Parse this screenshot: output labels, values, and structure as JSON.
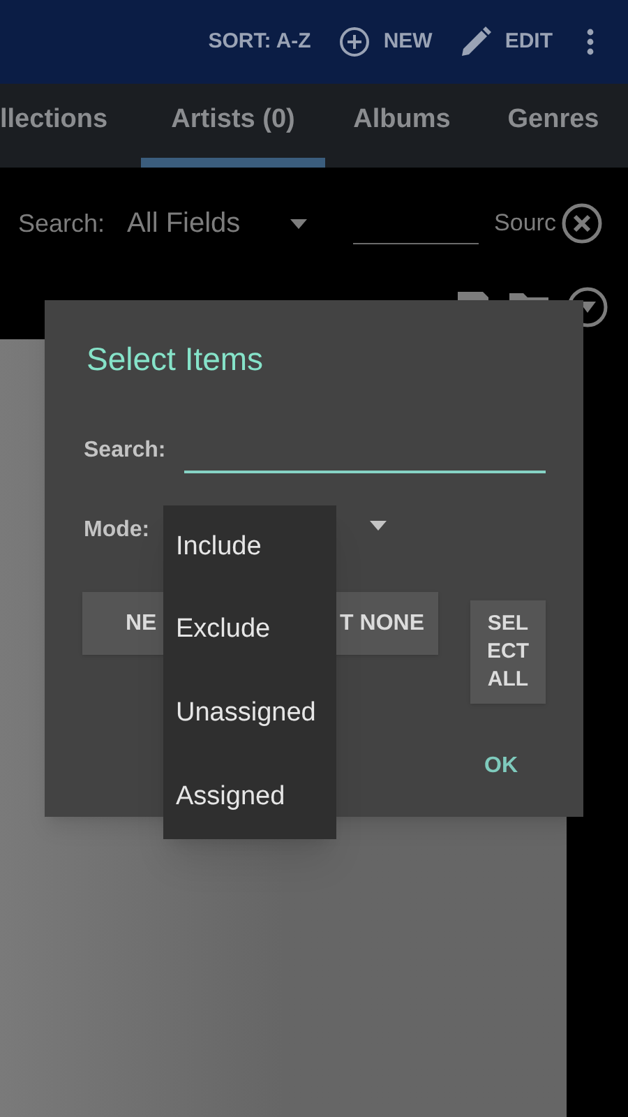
{
  "app_bar": {
    "actions": [
      {
        "kind": "text",
        "label": "SORT: A-Z"
      },
      {
        "kind": "plus",
        "label": "NEW"
      },
      {
        "kind": "pencil",
        "label": "EDIT"
      },
      {
        "kind": "more"
      }
    ]
  },
  "tabs": [
    {
      "label": "llections",
      "selected": false
    },
    {
      "label": "Artists (0)",
      "selected": true
    },
    {
      "label": "Albums",
      "selected": false
    },
    {
      "label": "Genres",
      "selected": false
    }
  ],
  "filter": {
    "search_label": "Search:",
    "field_dropdown": "All Fields",
    "source_label": "Sourc"
  },
  "dialog": {
    "title": "Select Items",
    "search_label": "Search:",
    "mode_label": "Mode:",
    "buttons": [
      "NE",
      "T NONE",
      "SELECT ALL"
    ],
    "ok": "OK"
  },
  "menu": {
    "items": [
      "Include",
      "Exclude",
      "Unassigned",
      "Assigned"
    ]
  }
}
